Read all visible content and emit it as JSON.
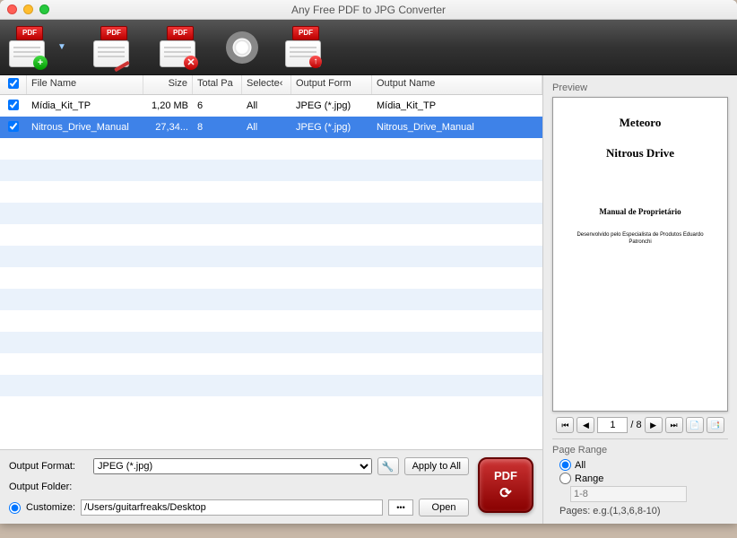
{
  "window": {
    "title": "Any Free PDF to JPG Converter"
  },
  "toolbar": {
    "pdf_label": "PDF"
  },
  "table": {
    "headers": {
      "filename": "File Name",
      "size": "Size",
      "totalp": "Total Pa",
      "selected": "Selecte‹",
      "outfmt": "Output Form",
      "outname": "Output Name"
    },
    "rows": [
      {
        "checked": true,
        "filename": "Mídia_Kit_TP",
        "size": "1,20 MB",
        "totalp": "6",
        "selected": "All",
        "outfmt": "JPEG (*.jpg)",
        "outname": "Mídia_Kit_TP",
        "sel": false
      },
      {
        "checked": true,
        "filename": "Nitrous_Drive_Manual",
        "size": "27,34...",
        "totalp": "8",
        "selected": "All",
        "outfmt": "JPEG (*.jpg)",
        "outname": "Nitrous_Drive_Manual",
        "sel": true
      }
    ]
  },
  "output": {
    "format_label": "Output Format:",
    "format_value": "JPEG (*.jpg)",
    "apply": "Apply to All",
    "folder_label": "Output Folder:",
    "customize": "Customize:",
    "path": "/Users/guitarfreaks/Desktop",
    "browse": "•••",
    "open": "Open",
    "pdf": "PDF"
  },
  "preview": {
    "head": "Preview",
    "doc": {
      "t1": "Meteoro",
      "t2": "Nitrous Drive",
      "t3": "Manual de Proprietário",
      "t4": "Desenvolvido pelo Especialista de Produtos\nEduardo Patronchi"
    },
    "pager": {
      "current": "1",
      "sep": "/",
      "total": "8"
    }
  },
  "pagerange": {
    "head": "Page Range",
    "all": "All",
    "range": "Range",
    "range_placeholder": "1-8",
    "hint": "Pages: e.g.(1,3,6,8-10)"
  }
}
